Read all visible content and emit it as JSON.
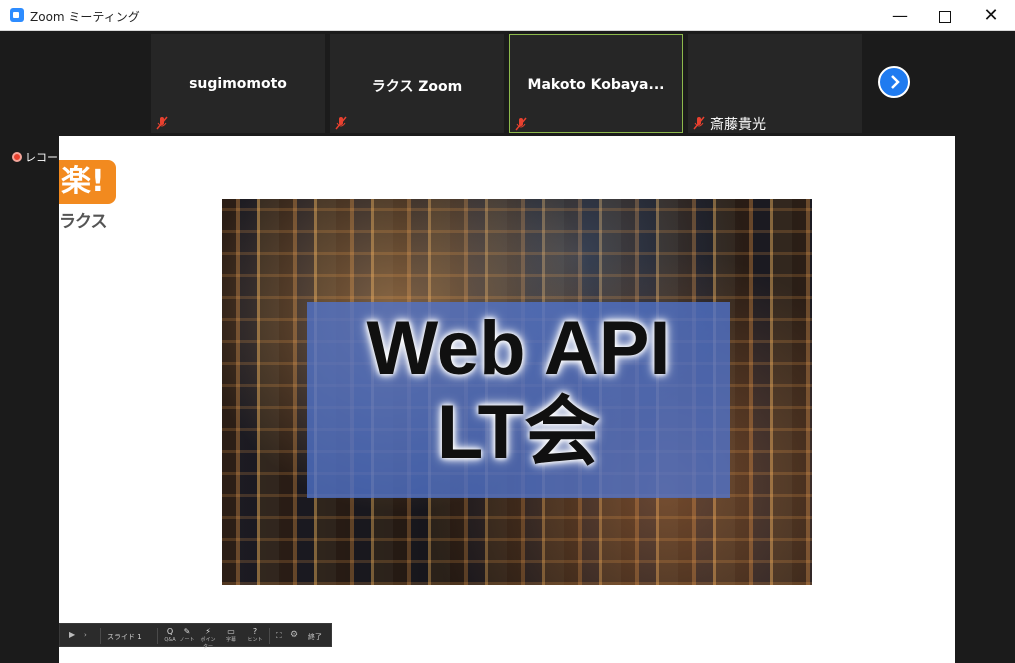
{
  "window": {
    "title": "Zoom ミーティング",
    "minimize": "—",
    "close": "✕"
  },
  "participants": [
    {
      "name": "sugimomoto",
      "muted": true
    },
    {
      "name": "ラクス Zoom",
      "muted": true
    },
    {
      "name": "Makoto Kobaya...",
      "muted": true,
      "active": true
    },
    {
      "name": "斎藤貴光",
      "muted": true
    }
  ],
  "recording": {
    "label": "レコー"
  },
  "slide": {
    "logo_mark": "楽!",
    "logo_text": "ラクス",
    "title_line1": "Web API",
    "title_line2": "LT会"
  },
  "toolbar": {
    "play": "▶",
    "next": "›",
    "slide_label": "スライド 1",
    "items": [
      {
        "icon": "Q",
        "label": "Q&A"
      },
      {
        "icon": "✎",
        "label": "ノート"
      },
      {
        "icon": "⚡",
        "label": "ポインター"
      },
      {
        "icon": "▭",
        "label": "字幕"
      },
      {
        "icon": "?",
        "label": "ヒント"
      }
    ],
    "end_label": "終了"
  },
  "colors": {
    "accent": "#1f7bf0",
    "active_border": "#8db94c",
    "record": "#e8412f",
    "logo": "#f28a1f"
  }
}
